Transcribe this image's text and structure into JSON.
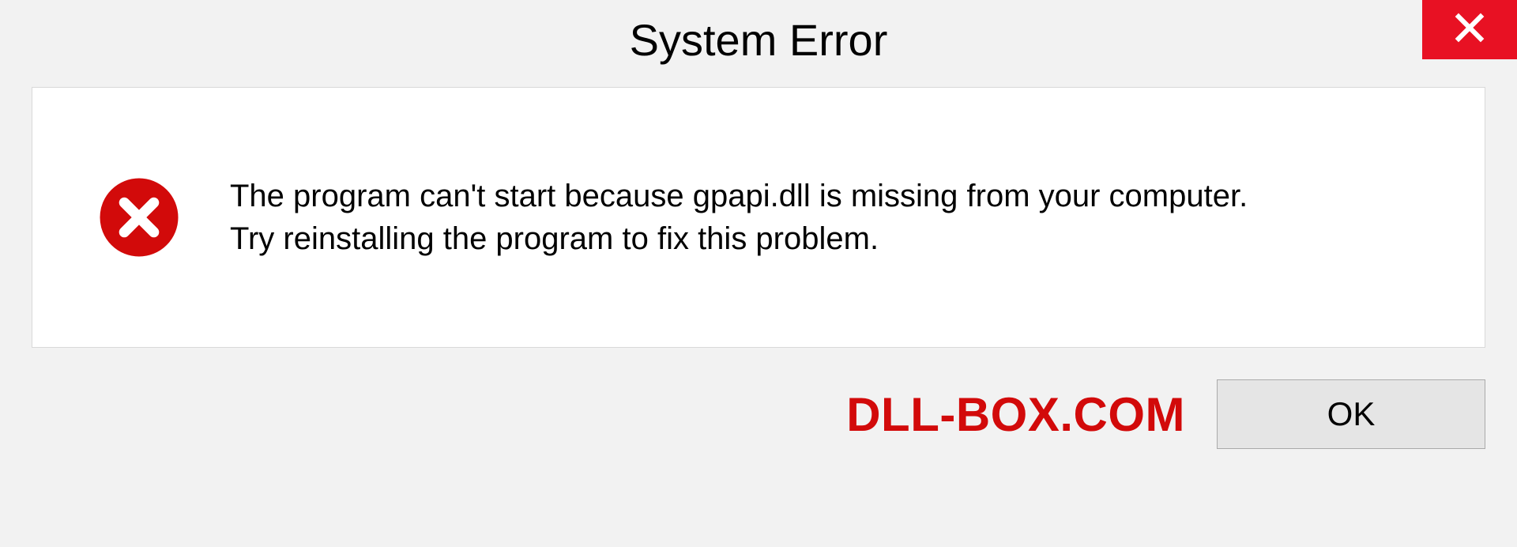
{
  "dialog": {
    "title": "System Error",
    "message_line1": "The program can't start because gpapi.dll is missing from your computer.",
    "message_line2": "Try reinstalling the program to fix this problem.",
    "ok_label": "OK"
  },
  "watermark": {
    "text": "DLL-BOX.COM"
  },
  "colors": {
    "close_bg": "#e81123",
    "error_red": "#d20a0a"
  }
}
